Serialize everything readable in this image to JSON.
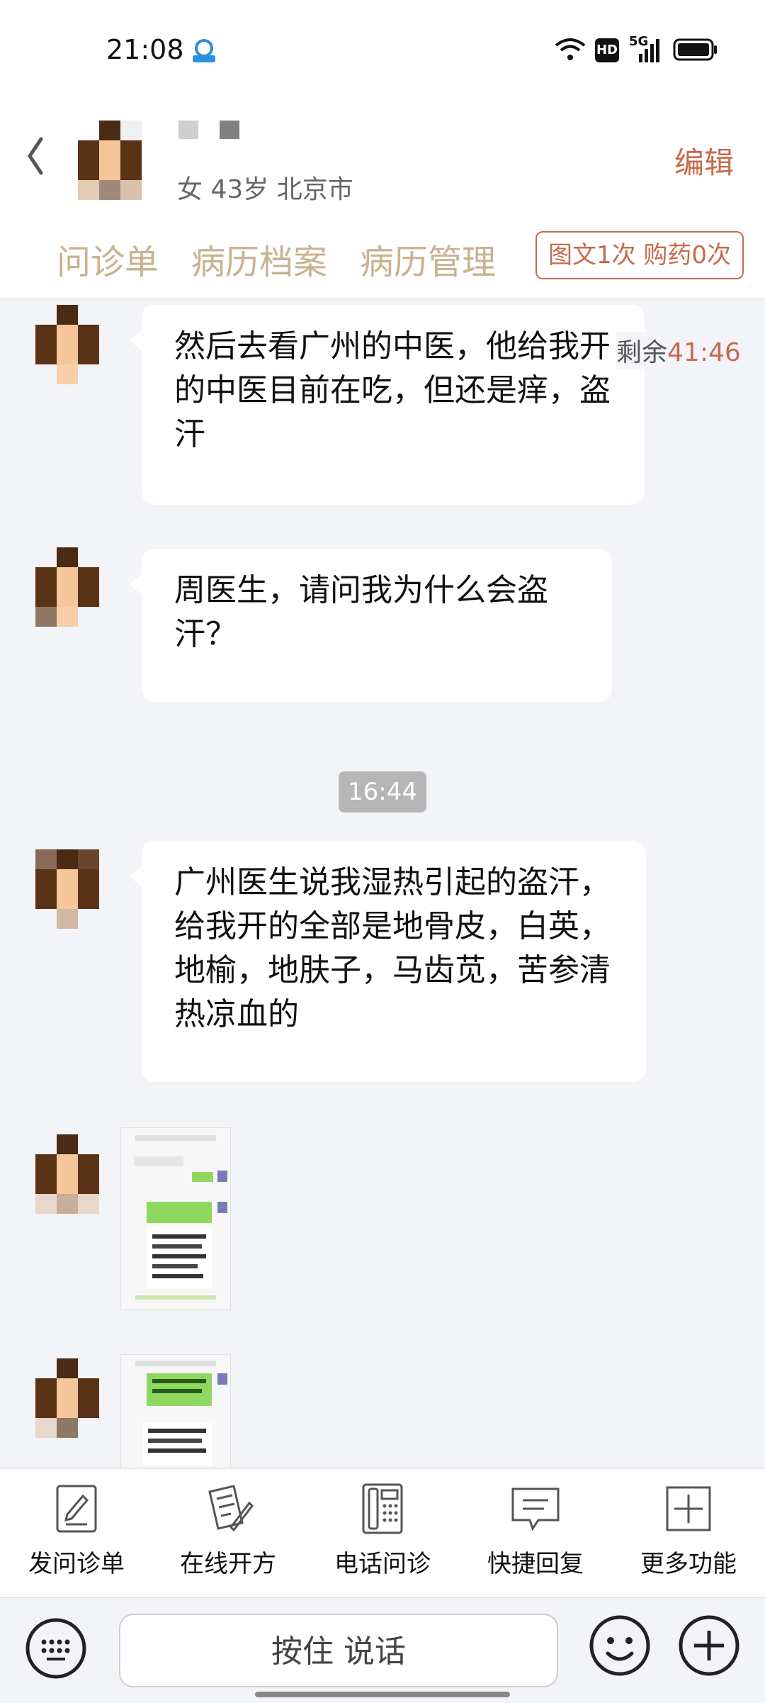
{
  "status_bar": {
    "time": "21:08",
    "hd_label": "HD",
    "network_label": "5G"
  },
  "header": {
    "patient_info": "女 43岁  北京市",
    "edit_label": "编辑",
    "tabs": [
      {
        "label": "问诊单"
      },
      {
        "label": "病历档案"
      },
      {
        "label": "病历管理"
      }
    ],
    "quota": "图文1次 购药0次"
  },
  "countdown": {
    "label": "剩余",
    "time": "41:46"
  },
  "messages": [
    {
      "text": "然后去看广州的中医，他给我开的中医目前在吃，但还是痒，盗汗"
    },
    {
      "text": "周医生，请问我为什么会盗汗？"
    },
    {
      "text": "广州医生说我湿热引起的盗汗，给我开的全部是地骨皮，白英，地榆，地肤子，马齿苋，苦参清热凉血的"
    }
  ],
  "time_divider": "16:44",
  "toolbar": {
    "items": [
      {
        "label": "发问诊单",
        "icon": "form-icon"
      },
      {
        "label": "在线开方",
        "icon": "prescription-icon"
      },
      {
        "label": "电话问诊",
        "icon": "phone-icon"
      },
      {
        "label": "快捷回复",
        "icon": "quick-reply-icon"
      },
      {
        "label": "更多功能",
        "icon": "plus-square-icon"
      }
    ]
  },
  "input_bar": {
    "voice_label": "按住 说话"
  },
  "colors": {
    "accent": "#c76a4c",
    "tab_text": "#c9b28f",
    "background": "#f3f4f8"
  }
}
